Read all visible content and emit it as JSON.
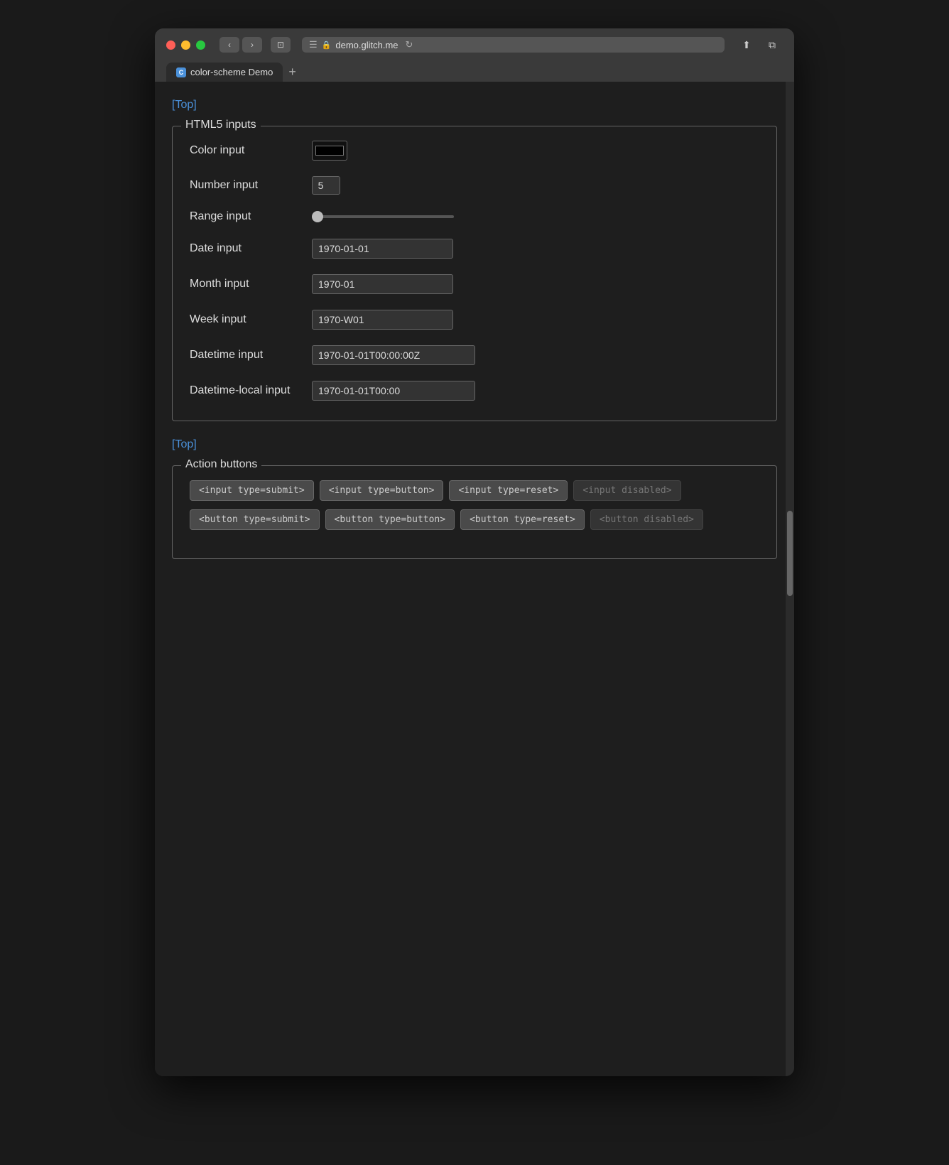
{
  "browser": {
    "address": "demo.glitch.me",
    "tab_title": "color-scheme Demo",
    "tab_favicon": "C",
    "back_label": "‹",
    "forward_label": "›",
    "sidebar_label": "⊡",
    "hamburger_label": "☰",
    "reload_label": "↻",
    "share_label": "⬆",
    "new_window_label": "⧉",
    "new_tab_label": "+"
  },
  "page": {
    "top_link": "[Top]",
    "top_link2": "[Top]",
    "html5_section": {
      "legend": "HTML5 inputs",
      "color_label": "Color input",
      "color_value": "#000000",
      "number_label": "Number input",
      "number_value": "5",
      "range_label": "Range input",
      "range_value": "0",
      "date_label": "Date input",
      "date_value": "1970-01-01",
      "month_label": "Month input",
      "month_value": "1970-01",
      "week_label": "Week input",
      "week_value": "1970-W01",
      "datetime_label": "Datetime input",
      "datetime_value": "1970-01-01T00:00:00Z",
      "datetime_local_label": "Datetime-local input",
      "datetime_local_value": "1970-01-01T00:00"
    },
    "action_section": {
      "legend": "Action buttons",
      "btn1": "<input type=submit>",
      "btn2": "<input type=button>",
      "btn3": "<input type=reset>",
      "btn4": "<input disabled>",
      "btn5": "<button type=submit>",
      "btn6": "<button type=button>",
      "btn7": "<button type=reset>",
      "btn8": "<button disabled>"
    }
  }
}
